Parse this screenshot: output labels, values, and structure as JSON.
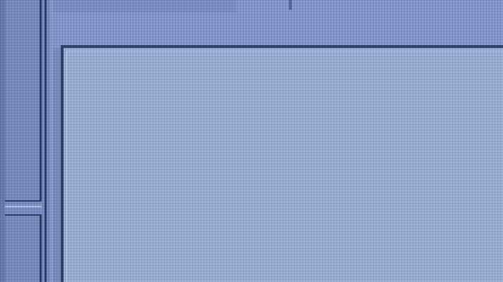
{
  "window": {
    "title_fragment": ""
  },
  "colors": {
    "sidebar": "#7d8fc1",
    "divider": "#2f3c68",
    "header": "#899ad0",
    "content": "#a0b3d8"
  }
}
